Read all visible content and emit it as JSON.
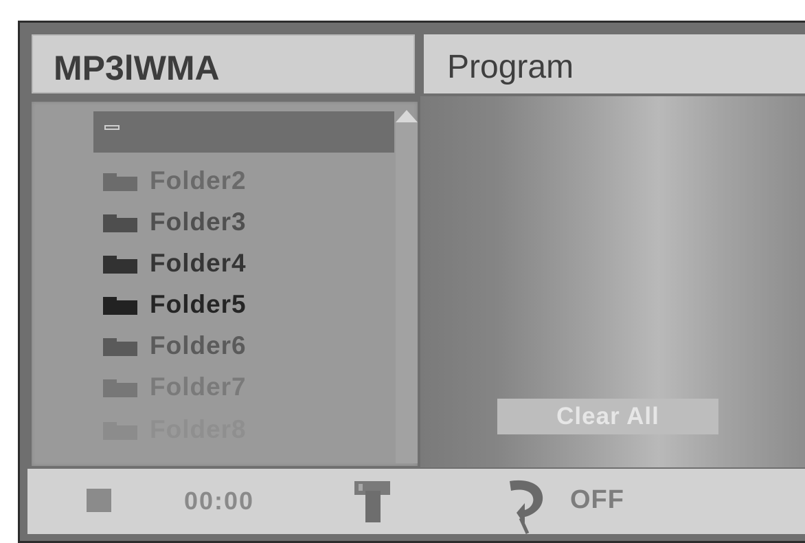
{
  "panels": {
    "left_title": "MP3lWMA",
    "right_title": "Program"
  },
  "file_list": {
    "items": [
      {
        "type": "parent-folder",
        "label": ""
      },
      {
        "type": "folder",
        "label": "Folder2"
      },
      {
        "type": "folder",
        "label": "Folder3"
      },
      {
        "type": "folder",
        "label": "Folder4"
      },
      {
        "type": "folder",
        "label": "Folder5"
      },
      {
        "type": "folder",
        "label": "Folder6"
      },
      {
        "type": "folder",
        "label": "Folder7"
      },
      {
        "type": "folder",
        "label": "Folder8"
      }
    ],
    "selected_index": 0
  },
  "program": {
    "clear_all_label": "Clear All"
  },
  "status": {
    "time": "00:00",
    "repeat": "OFF",
    "stop_icon": "stop-icon",
    "title_icon": "title-icon",
    "repeat_icon": "repeat-icon"
  },
  "colors": {
    "selected_row": "#6e6e6e",
    "list_bg": "#9a9a9a",
    "header_bg": "#cfcfcf"
  }
}
